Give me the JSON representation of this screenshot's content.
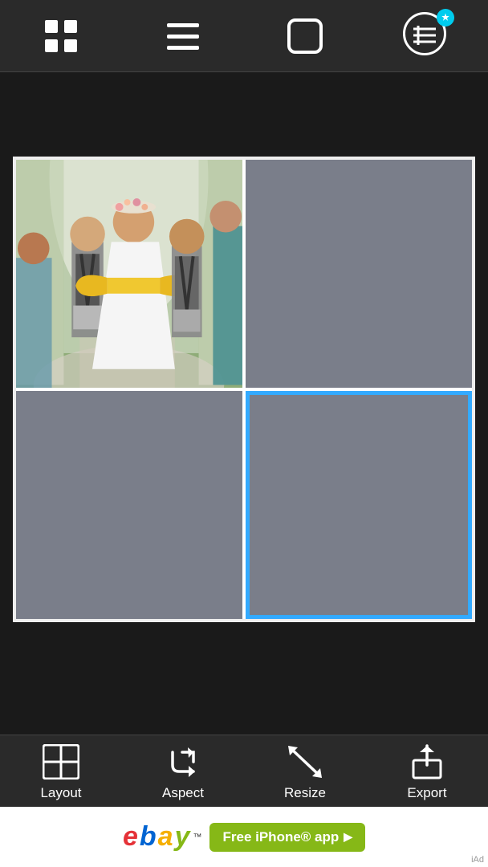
{
  "topbar": {
    "grid_icon": "grid-icon",
    "menu_icon": "menu-icon",
    "frame_icon": "frame-icon",
    "profile_icon": "profile-icon",
    "lock_badge": "lock-badge-icon"
  },
  "grid": {
    "cells": [
      {
        "id": "cell-top-left",
        "type": "photo",
        "highlighted": false
      },
      {
        "id": "cell-top-right",
        "type": "empty",
        "highlighted": false
      },
      {
        "id": "cell-bottom-left",
        "type": "empty",
        "highlighted": false
      },
      {
        "id": "cell-bottom-right",
        "type": "empty",
        "highlighted": true
      }
    ]
  },
  "toolbar": {
    "items": [
      {
        "id": "layout",
        "label": "Layout"
      },
      {
        "id": "aspect",
        "label": "Aspect"
      },
      {
        "id": "resize",
        "label": "Resize"
      },
      {
        "id": "export",
        "label": "Export"
      }
    ]
  },
  "ad": {
    "brand": "ebay",
    "trademark": "™",
    "cta_label": "Free iPhone® app",
    "label": "iAd"
  }
}
